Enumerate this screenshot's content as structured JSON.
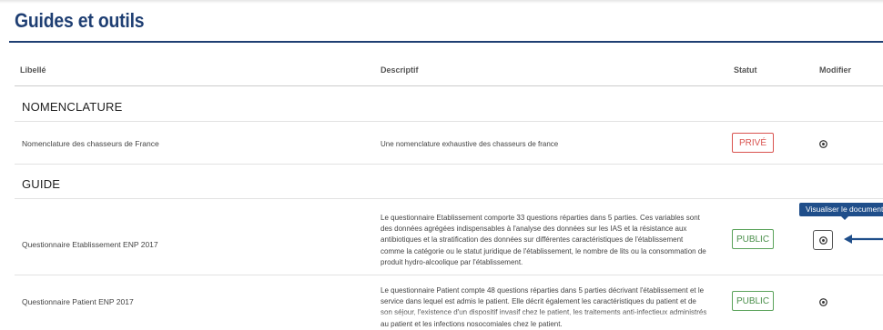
{
  "page": {
    "title": "Guides et outils"
  },
  "table": {
    "headers": {
      "libelle": "Libellé",
      "descriptif": "Descriptif",
      "statut": "Statut",
      "modifier": "Modifier"
    }
  },
  "sections": [
    {
      "title": "NOMENCLATURE",
      "rows": [
        {
          "libelle": "Nomenclature des chasseurs de France",
          "descriptif": "Une nomenclature exhaustive des chasseurs de france",
          "statut": "PRIVÉ",
          "statut_color": "#d9534f"
        }
      ]
    },
    {
      "title": "GUIDE",
      "rows": [
        {
          "libelle": "Questionnaire Etablissement ENP 2017",
          "descriptif": "Le questionnaire Etablissement comporte 33 questions réparties dans 5 parties. Ces variables sont des données agrégées indispensables à l'analyse des données sur les IAS et la résistance aux antibiotiques et la stratification des données sur différentes caractéristiques de l'établissement comme la catégorie ou le statut juridique de l'établissement, le nombre de lits ou la consommation de produit hydro-alcoolique par l'établissement.",
          "statut": "PUBLIC",
          "statut_color": "#5aa25a"
        },
        {
          "libelle": "Questionnaire Patient ENP 2017",
          "descriptif": "Le questionnaire Patient compte 48 questions réparties dans 5 parties décrivant l'établissement et le service dans lequel est admis le patient. Elle décrit également les caractéristiques du patient et de son séjour, l'existence d'un dispositif invasif chez le patient, les traitements anti-infectieux administrés au patient et les infections nosocomiales chez le patient.",
          "statut": "PUBLIC",
          "statut_color": "#5aa25a"
        }
      ]
    }
  ],
  "tooltip": {
    "text": "Visualiser le document"
  },
  "icons": {
    "edit": "eye-icon",
    "pointer": "arrow-left-icon"
  },
  "colors": {
    "brand": "#1f3f73",
    "tooltip_bg": "#1f4e8a"
  }
}
